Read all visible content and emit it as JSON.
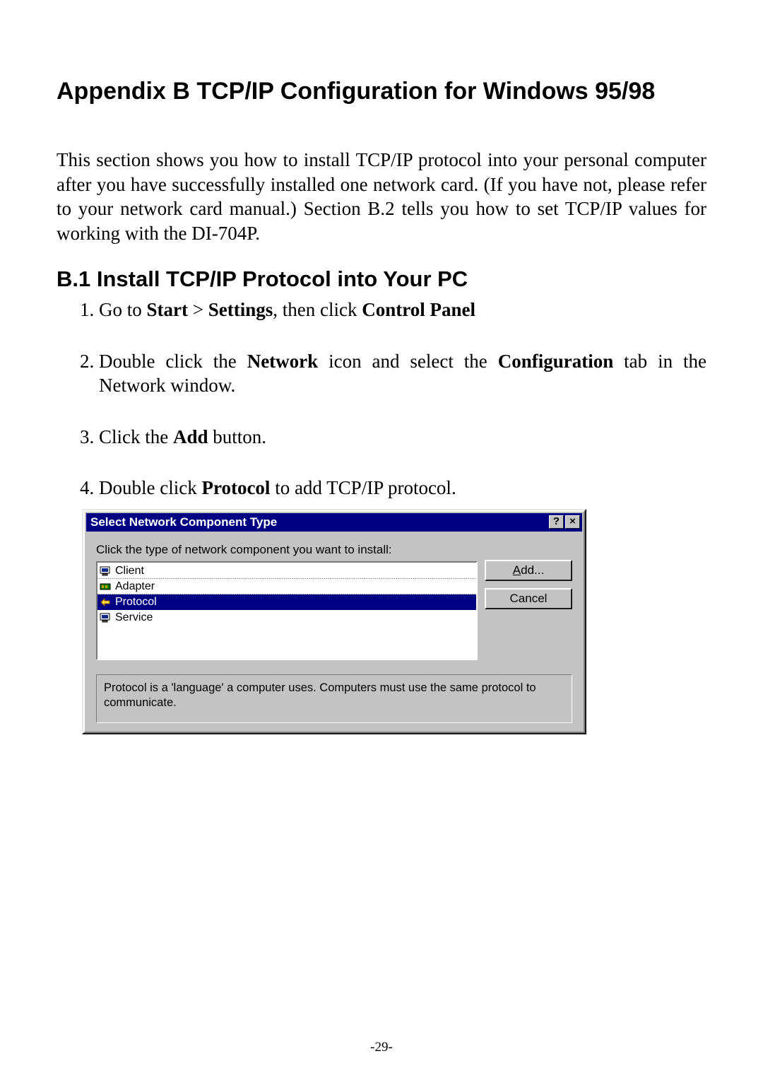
{
  "heading": "Appendix B  TCP/IP Configuration for Windows 95/98",
  "intro": "This section shows you how to install TCP/IP protocol into your personal computer after you have successfully installed one network card. (If you have not, please refer to your network card manual.) Section B.2 tells you how to set TCP/IP values for working with the DI-704P.",
  "subheading": "B.1 Install TCP/IP Protocol into Your PC",
  "steps": {
    "s1_pre": "Go to ",
    "s1_b1": "Start",
    "s1_mid1": " > ",
    "s1_b2": "Settings",
    "s1_mid2": ", then click ",
    "s1_b3": "Control Panel",
    "s2_pre": "Double click the ",
    "s2_b1": "Network",
    "s2_mid1": " icon and select the ",
    "s2_b2": "Configuration",
    "s2_post": " tab in the Network window.",
    "s3_pre": "Click the ",
    "s3_b1": "Add",
    "s3_post": " button.",
    "s4_pre": "Double click ",
    "s4_b1": "Protocol",
    "s4_post": " to add TCP/IP protocol."
  },
  "dialog": {
    "title": "Select Network Component Type",
    "help_glyph": "?",
    "close_glyph": "×",
    "instruction": "Click the type of network component you want to install:",
    "items": {
      "i0": "Client",
      "i1": "Adapter",
      "i2": "Protocol",
      "i3": "Service"
    },
    "add_rest": "dd...",
    "add_ul": "A",
    "cancel": "Cancel",
    "description": "Protocol is a 'language' a computer uses. Computers must use the same protocol to communicate."
  },
  "page_number": "-29-"
}
